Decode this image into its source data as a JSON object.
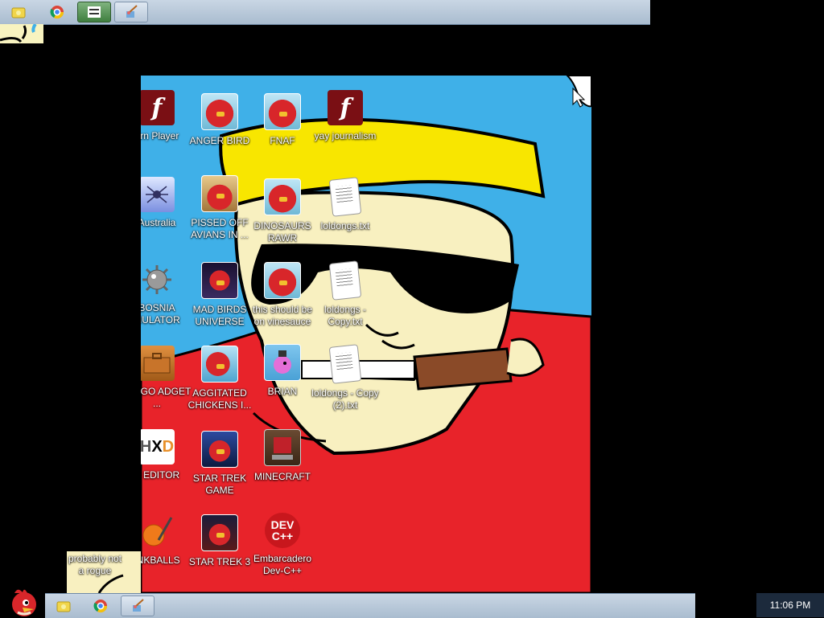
{
  "taskbar": {
    "clock": "11:06 PM",
    "top_buttons": [
      {
        "name": "folder"
      },
      {
        "name": "chrome"
      },
      {
        "name": "app"
      },
      {
        "name": "paint"
      }
    ],
    "bottom_buttons": [
      {
        "name": "folder"
      },
      {
        "name": "chrome"
      },
      {
        "name": "paint"
      }
    ]
  },
  "desktop": {
    "icons": [
      {
        "label": "orn Player",
        "icon": "flash-icon"
      },
      {
        "label": "ANGER BIRD",
        "icon": "angry-bird-icon"
      },
      {
        "label": "FNAF",
        "icon": "angry-bird-icon"
      },
      {
        "label": "yay journalism",
        "icon": "flash-icon"
      },
      {
        "label": "Australia",
        "icon": "spider-solitaire-icon"
      },
      {
        "label": "PISSED OFF AVIANS IN ...",
        "icon": "angry-bird-seasons-icon"
      },
      {
        "label": "DINOSAURS RAWR",
        "icon": "angry-bird-icon"
      },
      {
        "label": "loldongs.txt",
        "icon": "text-file-icon"
      },
      {
        "label": "BOSNIA MULATOR",
        "icon": "minesweeper-icon"
      },
      {
        "label": "MAD BIRDS UNIVERSE",
        "icon": "angry-bird-space-icon"
      },
      {
        "label": "this should be on vinesauce",
        "icon": "angry-bird-icon"
      },
      {
        "label": "loldongs - Copy.txt",
        "icon": "text-file-icon"
      },
      {
        "label": "GO GO ADGET ...",
        "icon": "gadget-icon"
      },
      {
        "label": "AGGITATED CHICKENS I...",
        "icon": "angry-bird-rio-icon"
      },
      {
        "label": "BRIAN",
        "icon": "bird-pink-icon"
      },
      {
        "label": "loldongs - Copy (2).txt",
        "icon": "text-file-icon"
      },
      {
        "label": "X EDITOR",
        "icon": "hxd-icon"
      },
      {
        "label": "STAR TREK GAME",
        "icon": "angry-bird-starwars-icon"
      },
      {
        "label": "MINECRAFT",
        "icon": "minecraft-icon"
      },
      {
        "label": "INKBALLS",
        "icon": "inkball-icon"
      },
      {
        "label": "STAR TREK 3",
        "icon": "angry-bird-starwars-2-icon"
      },
      {
        "label": "Embarcadero Dev-C++",
        "icon": "devcpp-icon"
      }
    ],
    "devcpp_logo_text": "DEV C++"
  },
  "scrap_label": "probably not a rogue",
  "colors": {
    "sky": "#3fb0e8",
    "hat": "#f8e600",
    "shirt": "#e8232a",
    "skin": "#f8f0c0"
  }
}
